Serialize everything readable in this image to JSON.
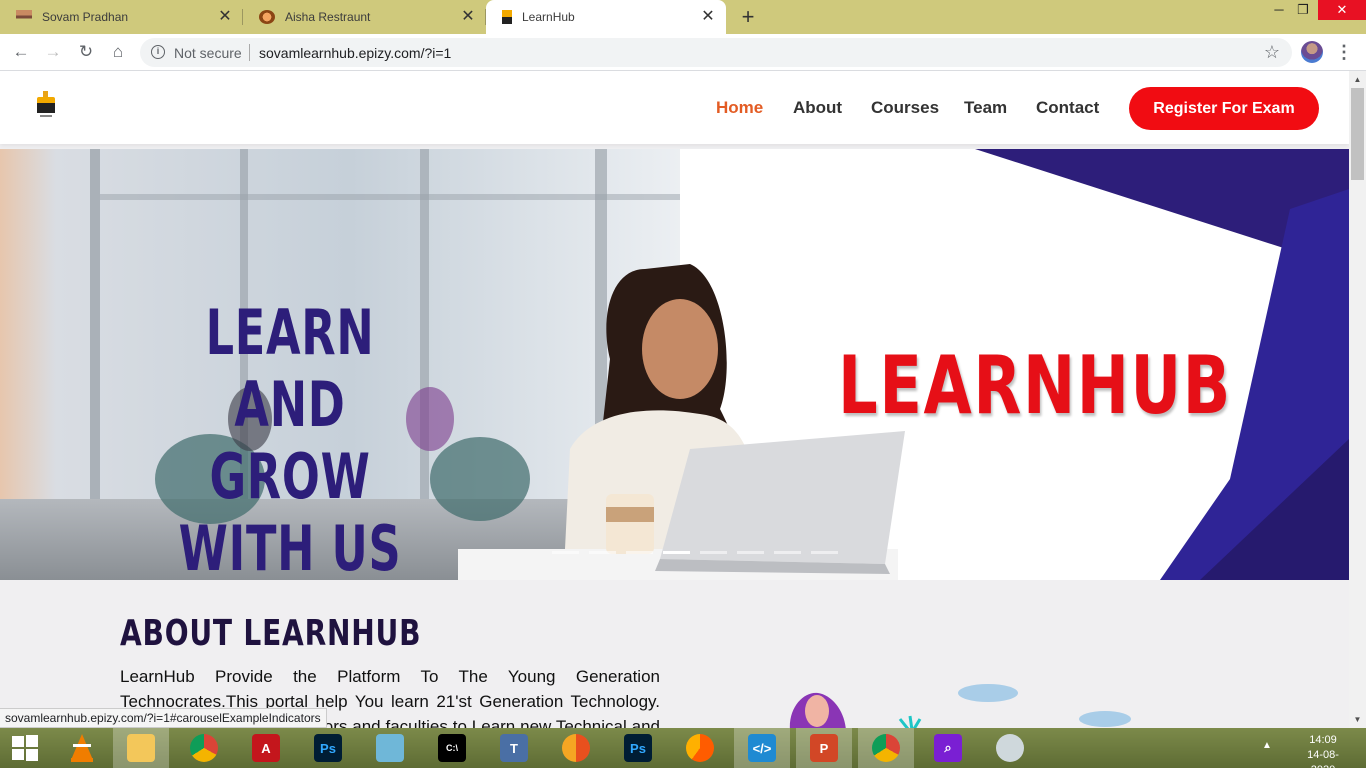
{
  "browser": {
    "tabs": [
      {
        "title": "Sovam Pradhan",
        "active": false
      },
      {
        "title": "Aisha Restraunt",
        "active": false
      },
      {
        "title": "LearnHub",
        "active": true
      }
    ],
    "security_label": "Not secure",
    "url": "sovamlearnhub.epizy.com/?i=1",
    "status_url": "sovamlearnhub.epizy.com/?i=1#carouselExampleIndicators"
  },
  "site": {
    "nav": [
      {
        "label": "Home",
        "active": true
      },
      {
        "label": "About",
        "active": false
      },
      {
        "label": "Courses",
        "active": false
      },
      {
        "label": "Team",
        "active": false
      },
      {
        "label": "Contact",
        "active": false
      }
    ],
    "cta_label": "Register For Exam",
    "hero": {
      "headline_line1": "LEARN AND GROW",
      "headline_line2": "WITH US",
      "brand": "LEARNHUB",
      "slide_count": 8,
      "active_slide": 3
    },
    "about": {
      "title": "ABOUT LEARNHUB",
      "text_line1": "LearnHub Provide the Platform To The Young Generation",
      "text_line2": "Technocrates.This portal help You learn 21'st Generation Technology.",
      "text_line3": "Learn with the best instructors and faculties to Learn new Technical and"
    }
  },
  "taskbar": {
    "apps": [
      "windows-start",
      "vlc",
      "file-explorer",
      "chrome",
      "acrobat",
      "photoshop",
      "notepad",
      "cmd",
      "typing-tool",
      "edge",
      "photoshop",
      "firefox",
      "vscode",
      "powerpoint",
      "chrome",
      "search-tool",
      "paint"
    ],
    "time": "14:09",
    "date": "14-08-2020"
  },
  "colors": {
    "accent_red": "#f10c12",
    "nav_active": "#e35c24",
    "hero_purple": "#2d1e7a",
    "tab_strip": "#cfc97c"
  }
}
